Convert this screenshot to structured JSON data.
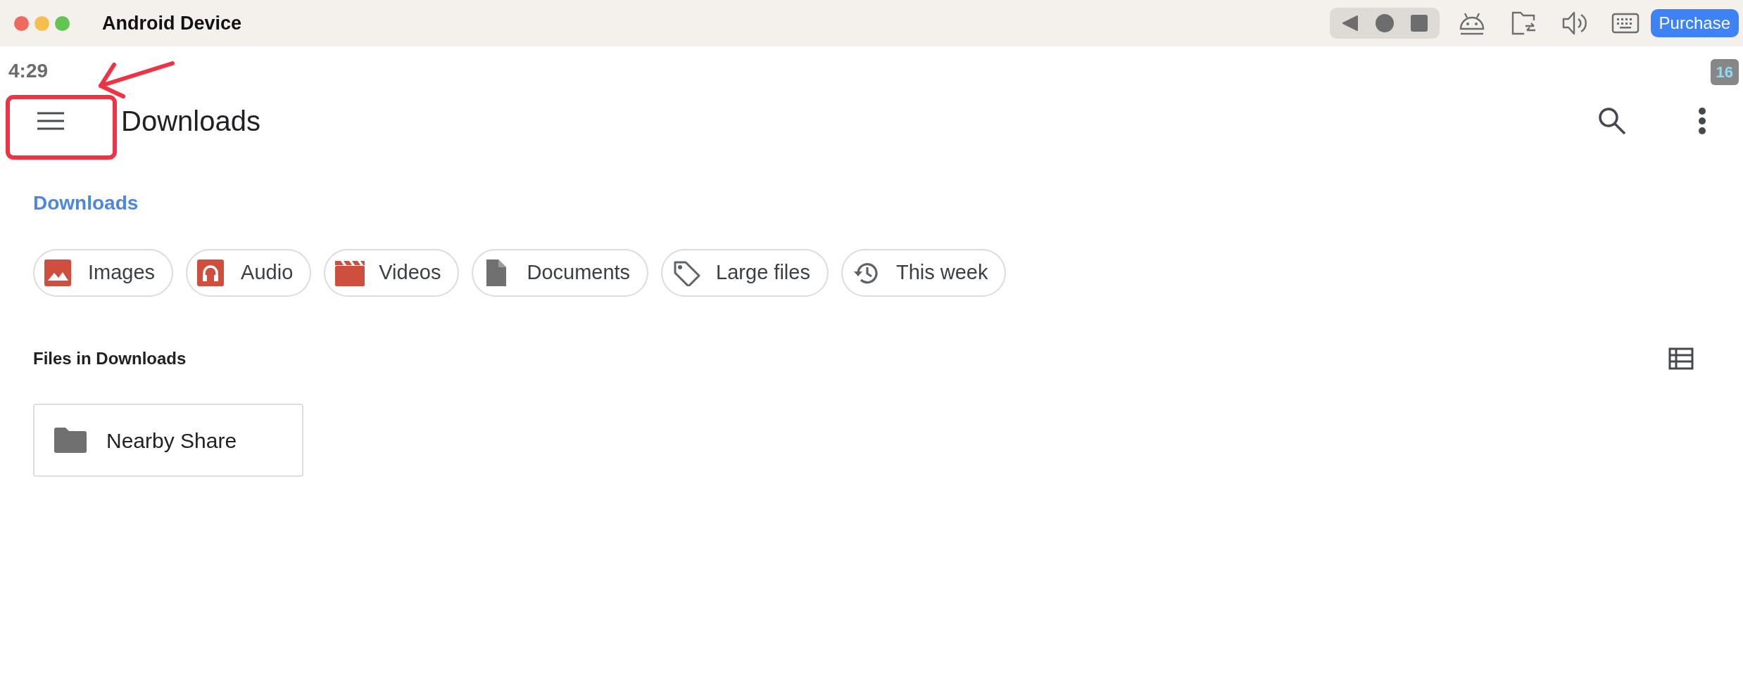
{
  "window": {
    "title": "Android Device",
    "purchase_button": "Purchase"
  },
  "status_bar": {
    "time": "4:29",
    "badge": "16"
  },
  "app_bar": {
    "title": "Downloads"
  },
  "breadcrumb": "Downloads",
  "chips": [
    {
      "label": "Images",
      "kind": "image"
    },
    {
      "label": "Audio",
      "kind": "audio"
    },
    {
      "label": "Videos",
      "kind": "video"
    },
    {
      "label": "Documents",
      "kind": "document"
    },
    {
      "label": "Large files",
      "kind": "tag"
    },
    {
      "label": "This week",
      "kind": "history"
    }
  ],
  "section_title": "Files in Downloads",
  "files": [
    {
      "name": "Nearby Share",
      "kind": "folder"
    }
  ]
}
